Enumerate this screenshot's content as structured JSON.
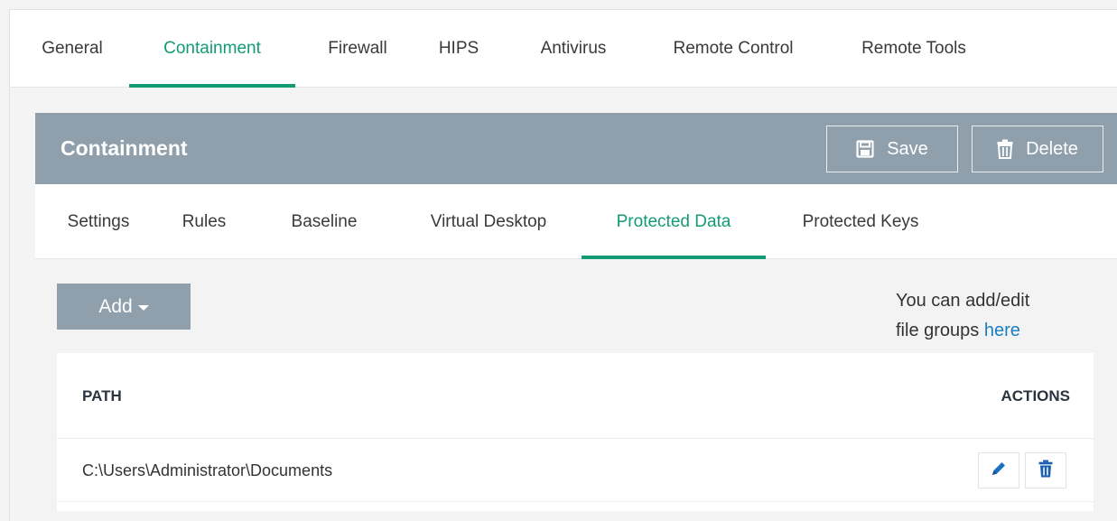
{
  "top_tabs": [
    {
      "label": "General"
    },
    {
      "label": "Containment",
      "active": true
    },
    {
      "label": "Firewall"
    },
    {
      "label": "HIPS"
    },
    {
      "label": "Antivirus"
    },
    {
      "label": "Remote Control"
    },
    {
      "label": "Remote Tools"
    }
  ],
  "panel": {
    "title": "Containment",
    "save_label": "Save",
    "delete_label": "Delete",
    "save_icon": "floppy-disk-icon",
    "delete_icon": "trash-icon"
  },
  "sub_tabs": [
    {
      "label": "Settings"
    },
    {
      "label": "Rules"
    },
    {
      "label": "Baseline"
    },
    {
      "label": "Virtual Desktop"
    },
    {
      "label": "Protected Data",
      "active": true
    },
    {
      "label": "Protected Keys"
    }
  ],
  "toolbar": {
    "add_label": "Add"
  },
  "hint": {
    "line1": "You can add/edit",
    "line2_prefix": "file groups",
    "link_text": "here"
  },
  "table": {
    "columns": {
      "path": "PATH",
      "actions": "ACTIONS"
    },
    "rows": [
      {
        "path": "C:\\Users\\Administrator\\Documents"
      }
    ]
  },
  "colors": {
    "accent": "#139b75",
    "header_bg": "#8fa0ac",
    "link": "#1a7ec2",
    "edit_icon": "#1a6fbf",
    "delete_icon": "#1a5fb0"
  }
}
